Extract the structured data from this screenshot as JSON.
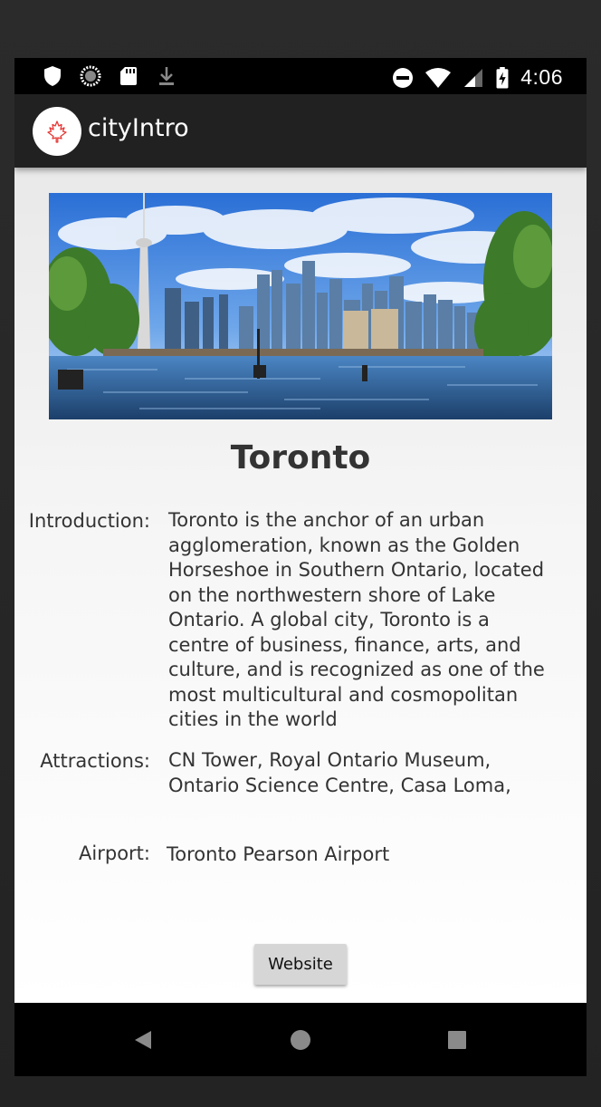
{
  "status_bar": {
    "time": "4:06",
    "left_icons": [
      "shield-icon",
      "sync-circle-icon",
      "sd-card-icon",
      "download-icon"
    ],
    "right_icons": [
      "do-not-disturb-icon",
      "wifi-icon",
      "signal-icon",
      "battery-charging-icon"
    ]
  },
  "app_bar": {
    "title": "cityIntro",
    "logo_icon": "maple-leaf-icon",
    "logo_color": "#e53935"
  },
  "city": {
    "name": "Toronto",
    "image_description": "Toronto skyline with CN Tower across the lake"
  },
  "details": {
    "intro_label": "Introduction:",
    "intro_lines": [
      "Toronto is the anchor of an urban",
      "agglomeration, known as the Golden",
      "Horseshoe in Southern Ontario, located",
      "on the northwestern shore of Lake",
      "Ontario. A global city, Toronto is a",
      "centre of business, finance, arts, and",
      "culture, and is recognized as one of the",
      "most multicultural and cosmopolitan",
      "cities in the world"
    ],
    "attractions_label": "Attractions:",
    "attractions_lines": [
      "CN Tower, Royal Ontario Museum,",
      "Ontario Science Centre, Casa Loma,"
    ],
    "airport_label": "Airport:",
    "airport_value": "Toronto Pearson Airport"
  },
  "actions": {
    "website_label": "Website"
  },
  "nav_bar": {
    "buttons": [
      "back-icon",
      "home-icon",
      "recents-icon"
    ]
  },
  "colors": {
    "app_bar": "#212121",
    "status_bar": "#000000",
    "button_bg": "#d6d6d6",
    "text": "#333333"
  }
}
